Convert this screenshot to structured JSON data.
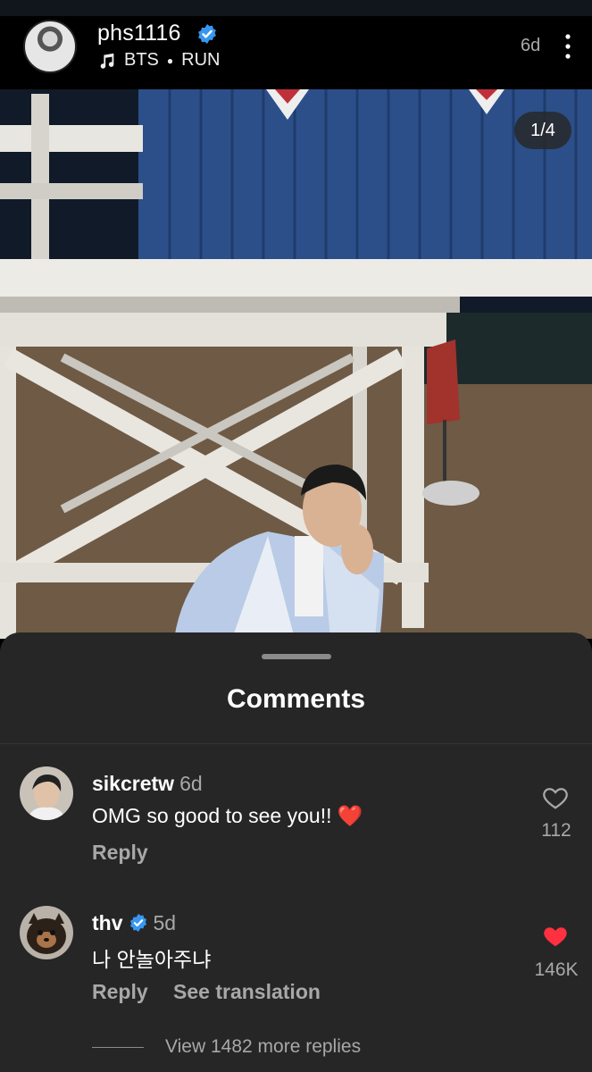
{
  "post": {
    "username": "phs1116",
    "artist": "BTS",
    "song": "RUN",
    "age": "6d",
    "counter": "1/4"
  },
  "icons": {
    "verified": "verified-badge-icon",
    "music": "music-note-icon",
    "more": "more-vertical-icon",
    "like": "heart-icon"
  },
  "colors": {
    "verified_blue": "#3897f0",
    "like_red": "#ff3040",
    "sheet_bg": "#262626"
  },
  "comments_sheet": {
    "title": "Comments",
    "comments": [
      {
        "username": "sikcretw",
        "time": "6d",
        "text": "OMG so good to see you!! ❤️",
        "reply_label": "Reply",
        "likes": "112",
        "liked": false
      },
      {
        "username": "thv",
        "time": "5d",
        "text": "나 안놀아주냐",
        "reply_label": "Reply",
        "translate_label": "See translation",
        "likes": "146K",
        "liked": true
      }
    ],
    "view_more": "View 1482 more replies"
  }
}
